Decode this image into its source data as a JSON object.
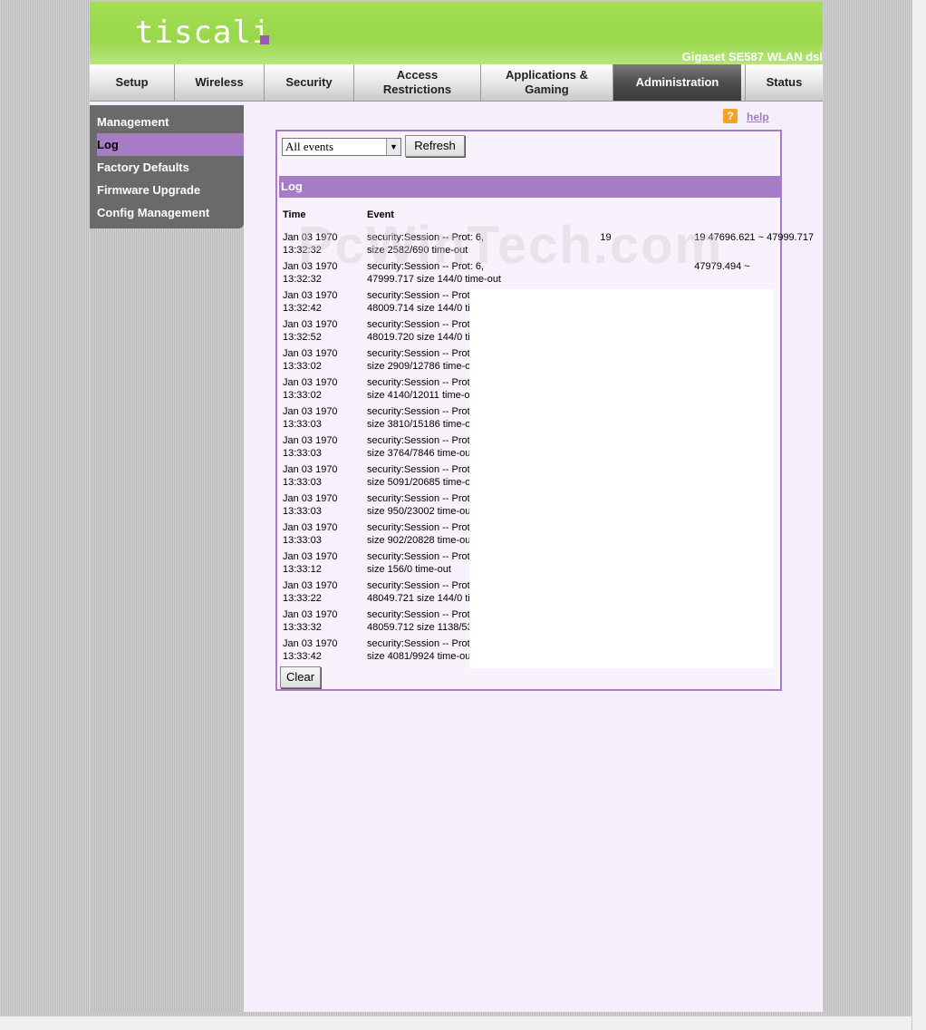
{
  "header": {
    "logo_text": "tiscali",
    "model": "Gigaset SE587 WLAN dsl"
  },
  "nav": {
    "tabs": [
      {
        "label": "Setup"
      },
      {
        "label": "Wireless"
      },
      {
        "label": "Security"
      },
      {
        "label": "Access\nRestrictions"
      },
      {
        "label": "Applications &\nGaming"
      },
      {
        "label": "Administration"
      },
      {
        "label": "Status"
      }
    ],
    "active": "Administration"
  },
  "sidebar": {
    "items": [
      {
        "label": "Management"
      },
      {
        "label": "Log"
      },
      {
        "label": "Factory Defaults"
      },
      {
        "label": "Firmware Upgrade"
      },
      {
        "label": "Config Management"
      }
    ],
    "active": "Log"
  },
  "help": {
    "label": "help",
    "icon": "question-icon"
  },
  "filter": {
    "selected": "All events"
  },
  "buttons": {
    "refresh": "Refresh",
    "clear": "Clear"
  },
  "log": {
    "title": "Log",
    "columns": {
      "time": "Time",
      "event": "Event"
    },
    "rows": [
      {
        "date": "Jan 03 1970",
        "time": "13:32:32",
        "line1": "security:Session -- Prot: 6,                                          19                              19 47696.621 ~ 47999.717",
        "line2": "size 2582/690 time-out"
      },
      {
        "date": "Jan 03 1970",
        "time": "13:32:32",
        "line1": "security:Session -- Prot: 6,                                                                            47979.494 ~",
        "line2": "47999.717 size 144/0 time-out"
      },
      {
        "date": "Jan 03 1970",
        "time": "13:32:42",
        "line1": "security:Session -- Prot",
        "line2": "48009.714 size 144/0 ti"
      },
      {
        "date": "Jan 03 1970",
        "time": "13:32:52",
        "line1": "security:Session -- Prot",
        "line2": "48019.720 size 144/0 ti"
      },
      {
        "date": "Jan 03 1970",
        "time": "13:33:02",
        "line1": "security:Session -- Prot",
        "line2": "size 2909/12786 time-o"
      },
      {
        "date": "Jan 03 1970",
        "time": "13:33:02",
        "line1": "security:Session -- Prot",
        "line2": "size 4140/12011 time-o"
      },
      {
        "date": "Jan 03 1970",
        "time": "13:33:03",
        "line1": "security:Session -- Prot",
        "line2": "size 3810/15186 time-o"
      },
      {
        "date": "Jan 03 1970",
        "time": "13:33:03",
        "line1": "security:Session -- Prot",
        "line2": "size 3764/7846 time-out"
      },
      {
        "date": "Jan 03 1970",
        "time": "13:33:03",
        "line1": "security:Session -- Prot",
        "line2": "size 5091/20685 time-o"
      },
      {
        "date": "Jan 03 1970",
        "time": "13:33:03",
        "line1": "security:Session -- Prot",
        "line2": "size 950/23002 time-out"
      },
      {
        "date": "Jan 03 1970",
        "time": "13:33:03",
        "line1": "security:Session -- Prot",
        "line2": "size 902/20828 time-out"
      },
      {
        "date": "Jan 03 1970",
        "time": "13:33:12",
        "line1": "security:Session -- Prot",
        "line2": "size 156/0 time-out"
      },
      {
        "date": "Jan 03 1970",
        "time": "13:33:22",
        "line1": "security:Session -- Prot",
        "line2": "48049.721 size 144/0 ti"
      },
      {
        "date": "Jan 03 1970",
        "time": "13:33:32",
        "line1": "security:Session -- Prot",
        "line2": "48059.712 size 1138/53"
      },
      {
        "date": "Jan 03 1970",
        "time": "13:33:42",
        "line1": "security:Session -- Prot",
        "line2": "size 4081/9924 time-out"
      }
    ]
  },
  "watermark": "PcWinTech.com",
  "colors": {
    "green": "#a3de55",
    "purple": "#a77cc6",
    "dark": "#4e4e4e"
  }
}
